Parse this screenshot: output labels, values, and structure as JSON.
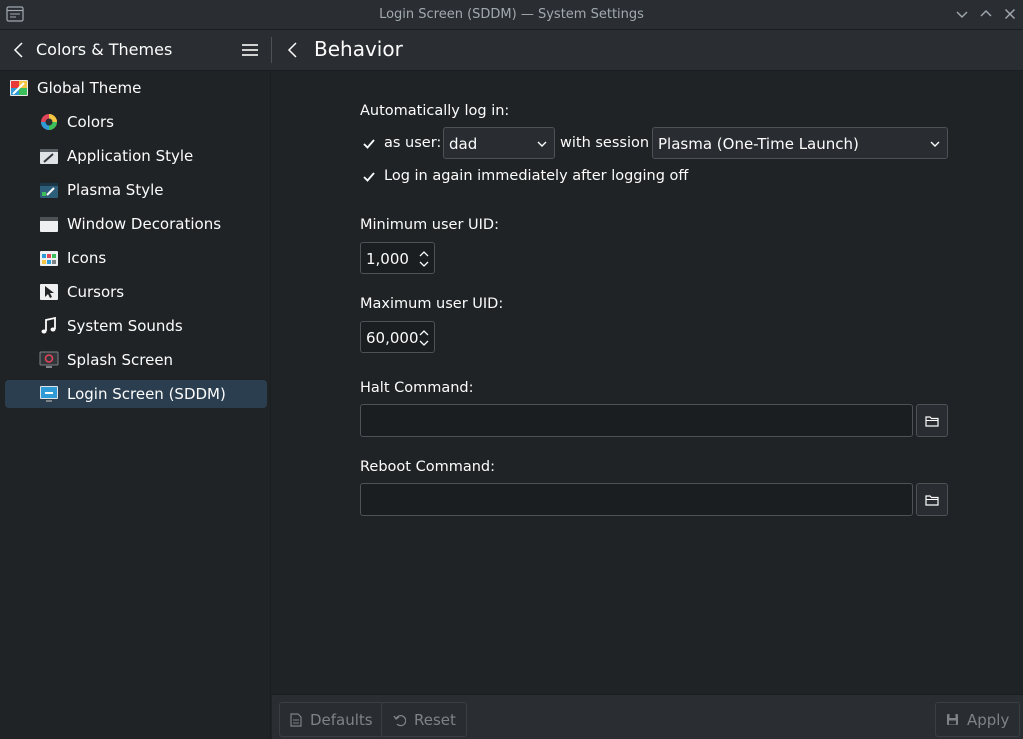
{
  "window": {
    "title": "Login Screen (SDDM) — System Settings"
  },
  "header": {
    "section": "Colors & Themes",
    "page": "Behavior"
  },
  "sidebar": {
    "items": [
      {
        "label": "Global Theme",
        "icon": "global-theme-icon"
      },
      {
        "label": "Colors",
        "icon": "colors-icon"
      },
      {
        "label": "Application Style",
        "icon": "application-style-icon"
      },
      {
        "label": "Plasma Style",
        "icon": "plasma-style-icon"
      },
      {
        "label": "Window Decorations",
        "icon": "window-decorations-icon"
      },
      {
        "label": "Icons",
        "icon": "icons-icon"
      },
      {
        "label": "Cursors",
        "icon": "cursors-icon"
      },
      {
        "label": "System Sounds",
        "icon": "system-sounds-icon"
      },
      {
        "label": "Splash Screen",
        "icon": "splash-screen-icon"
      },
      {
        "label": "Login Screen (SDDM)",
        "icon": "login-screen-icon",
        "active": true
      }
    ]
  },
  "behavior": {
    "autologin_heading": "Automatically log in:",
    "as_user_label": "as user:",
    "as_user_checked": true,
    "user_value": "dad",
    "with_session_label": "with session",
    "session_value": "Plasma (One-Time Launch)",
    "relogin_label": "Log in again immediately after logging off",
    "relogin_checked": true,
    "min_uid_label": "Minimum user UID:",
    "min_uid_value": "1,000",
    "max_uid_label": "Maximum user UID:",
    "max_uid_value": "60,000",
    "halt_label": "Halt Command:",
    "halt_value": "",
    "reboot_label": "Reboot Command:",
    "reboot_value": ""
  },
  "footer": {
    "defaults": "Defaults",
    "reset": "Reset",
    "apply": "Apply"
  },
  "colors": {
    "accent": "#3daee9",
    "selection": "#2b3e50",
    "background": "#202326"
  }
}
